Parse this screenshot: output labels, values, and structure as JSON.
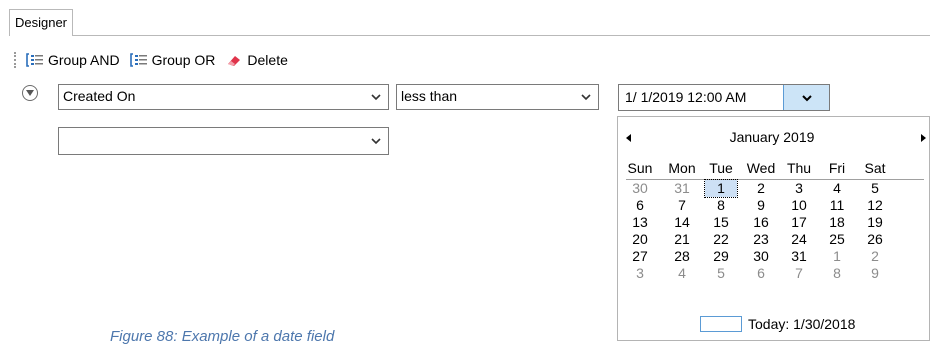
{
  "tab": {
    "label": "Designer"
  },
  "toolbar": {
    "group_and_label": "Group AND",
    "group_or_label": "Group OR",
    "delete_label": "Delete"
  },
  "filter": {
    "field_value": "Created On",
    "operator_value": "less than",
    "date_value": "1/  1/2019 12:00 AM",
    "second_field_value": ""
  },
  "calendar": {
    "month_label": "January 2019",
    "weekdays": [
      "Sun",
      "Mon",
      "Tue",
      "Wed",
      "Thu",
      "Fri",
      "Sat"
    ],
    "weeks": [
      [
        "30",
        "31",
        "1",
        "2",
        "3",
        "4",
        "5"
      ],
      [
        "6",
        "7",
        "8",
        "9",
        "10",
        "11",
        "12"
      ],
      [
        "13",
        "14",
        "15",
        "16",
        "17",
        "18",
        "19"
      ],
      [
        "20",
        "21",
        "22",
        "23",
        "24",
        "25",
        "26"
      ],
      [
        "27",
        "28",
        "29",
        "30",
        "31",
        "1",
        "2"
      ],
      [
        "3",
        "4",
        "5",
        "6",
        "7",
        "8",
        "9"
      ]
    ],
    "today_label": "Today: 1/30/2018"
  },
  "caption": "Figure 88: Example of a date field"
}
